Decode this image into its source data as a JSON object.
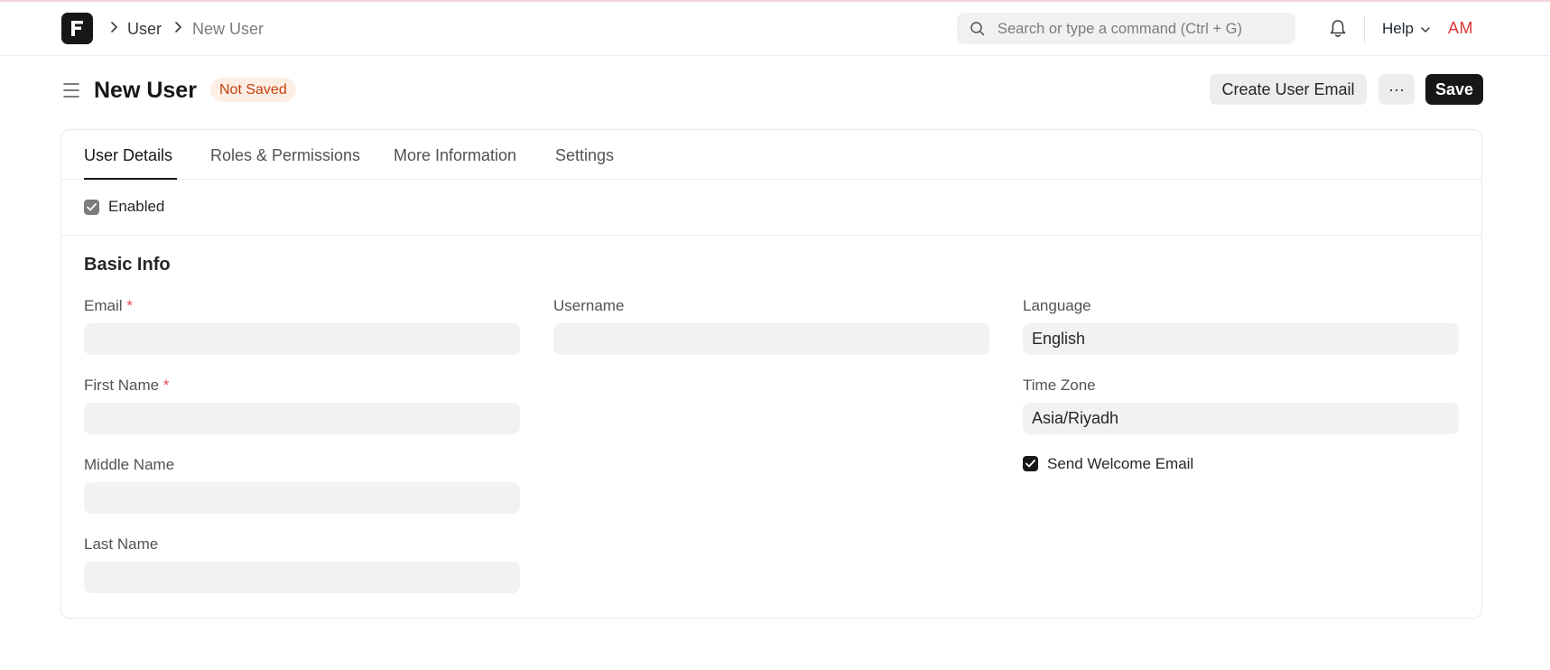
{
  "navbar": {
    "breadcrumbs": [
      "User",
      "New User"
    ],
    "search_placeholder": "Search or type a command (Ctrl + G)",
    "help_label": "Help",
    "avatar_initials": "AM"
  },
  "header": {
    "title": "New User",
    "status_badge": "Not Saved",
    "create_email_label": "Create User Email",
    "more_label": "···",
    "save_label": "Save"
  },
  "tabs": [
    {
      "label": "User Details",
      "active": true
    },
    {
      "label": "Roles & Permissions",
      "active": false
    },
    {
      "label": "More Information",
      "active": false
    },
    {
      "label": "Settings",
      "active": false
    }
  ],
  "enabled": {
    "label": "Enabled",
    "checked": true
  },
  "basic_info": {
    "title": "Basic Info",
    "email": {
      "label": "Email",
      "required": "*",
      "value": ""
    },
    "first_name": {
      "label": "First Name",
      "required": "*",
      "value": ""
    },
    "middle_name": {
      "label": "Middle Name",
      "value": ""
    },
    "last_name": {
      "label": "Last Name",
      "value": ""
    },
    "username": {
      "label": "Username",
      "value": ""
    },
    "language": {
      "label": "Language",
      "value": "English"
    },
    "time_zone": {
      "label": "Time Zone",
      "value": "Asia/Riyadh"
    },
    "send_welcome_email": {
      "label": "Send Welcome Email",
      "checked": true
    }
  },
  "colors": {
    "accent": "#171717",
    "badge_bg": "#fdeee4",
    "badge_text": "#c2410c",
    "avatar_text": "#e03636",
    "required_star": "#e24c4c"
  },
  "icons": [
    "frappe-logo-icon",
    "chevron-right-icon",
    "search-icon",
    "bell-icon",
    "chevron-down-icon",
    "hamburger-menu-icon",
    "checkmark-icon"
  ]
}
